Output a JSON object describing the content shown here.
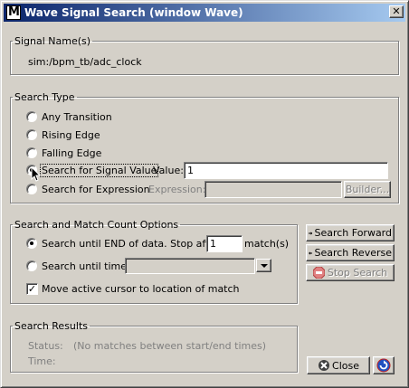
{
  "window": {
    "title": "Wave Signal Search (window Wave)",
    "close_label": "✕"
  },
  "signal_names": {
    "legend": "Signal Name(s)",
    "value": "sim:/bpm_tb/adc_clock"
  },
  "search_type": {
    "legend": "Search Type",
    "options": [
      {
        "label": "Any Transition",
        "checked": false
      },
      {
        "label": "Rising Edge",
        "checked": false
      },
      {
        "label": "Falling Edge",
        "checked": false
      },
      {
        "label": "Search for Signal Value",
        "checked": true
      },
      {
        "label": "Search for Expression",
        "checked": false
      }
    ],
    "value_label": "Value:",
    "value": "1",
    "expression_label": "Expression:",
    "expression_value": "",
    "builder_label": "Builder..."
  },
  "count_options": {
    "legend": "Search and Match Count Options",
    "until_end_label": "Search until END of data.  Stop after",
    "stop_after_value": "1",
    "match_suffix": "match(s)",
    "until_time_label": "Search until time:",
    "until_time_value": "",
    "move_cursor_label": "Move active cursor to location of match",
    "move_cursor_checked": true
  },
  "buttons": {
    "search_forward": "Search Forward",
    "search_reverse": "Search Reverse",
    "stop_search": "Stop Search",
    "close": "Close"
  },
  "results": {
    "legend": "Search Results",
    "status_label": "Status:",
    "status_value": "(No matches between start/end times)",
    "time_label": "Time:",
    "time_value": ""
  },
  "colors": {
    "title_start": "#0a246a",
    "title_end": "#a6caf0",
    "face": "#d4d0c8",
    "stop_icon": "#cc3333"
  }
}
